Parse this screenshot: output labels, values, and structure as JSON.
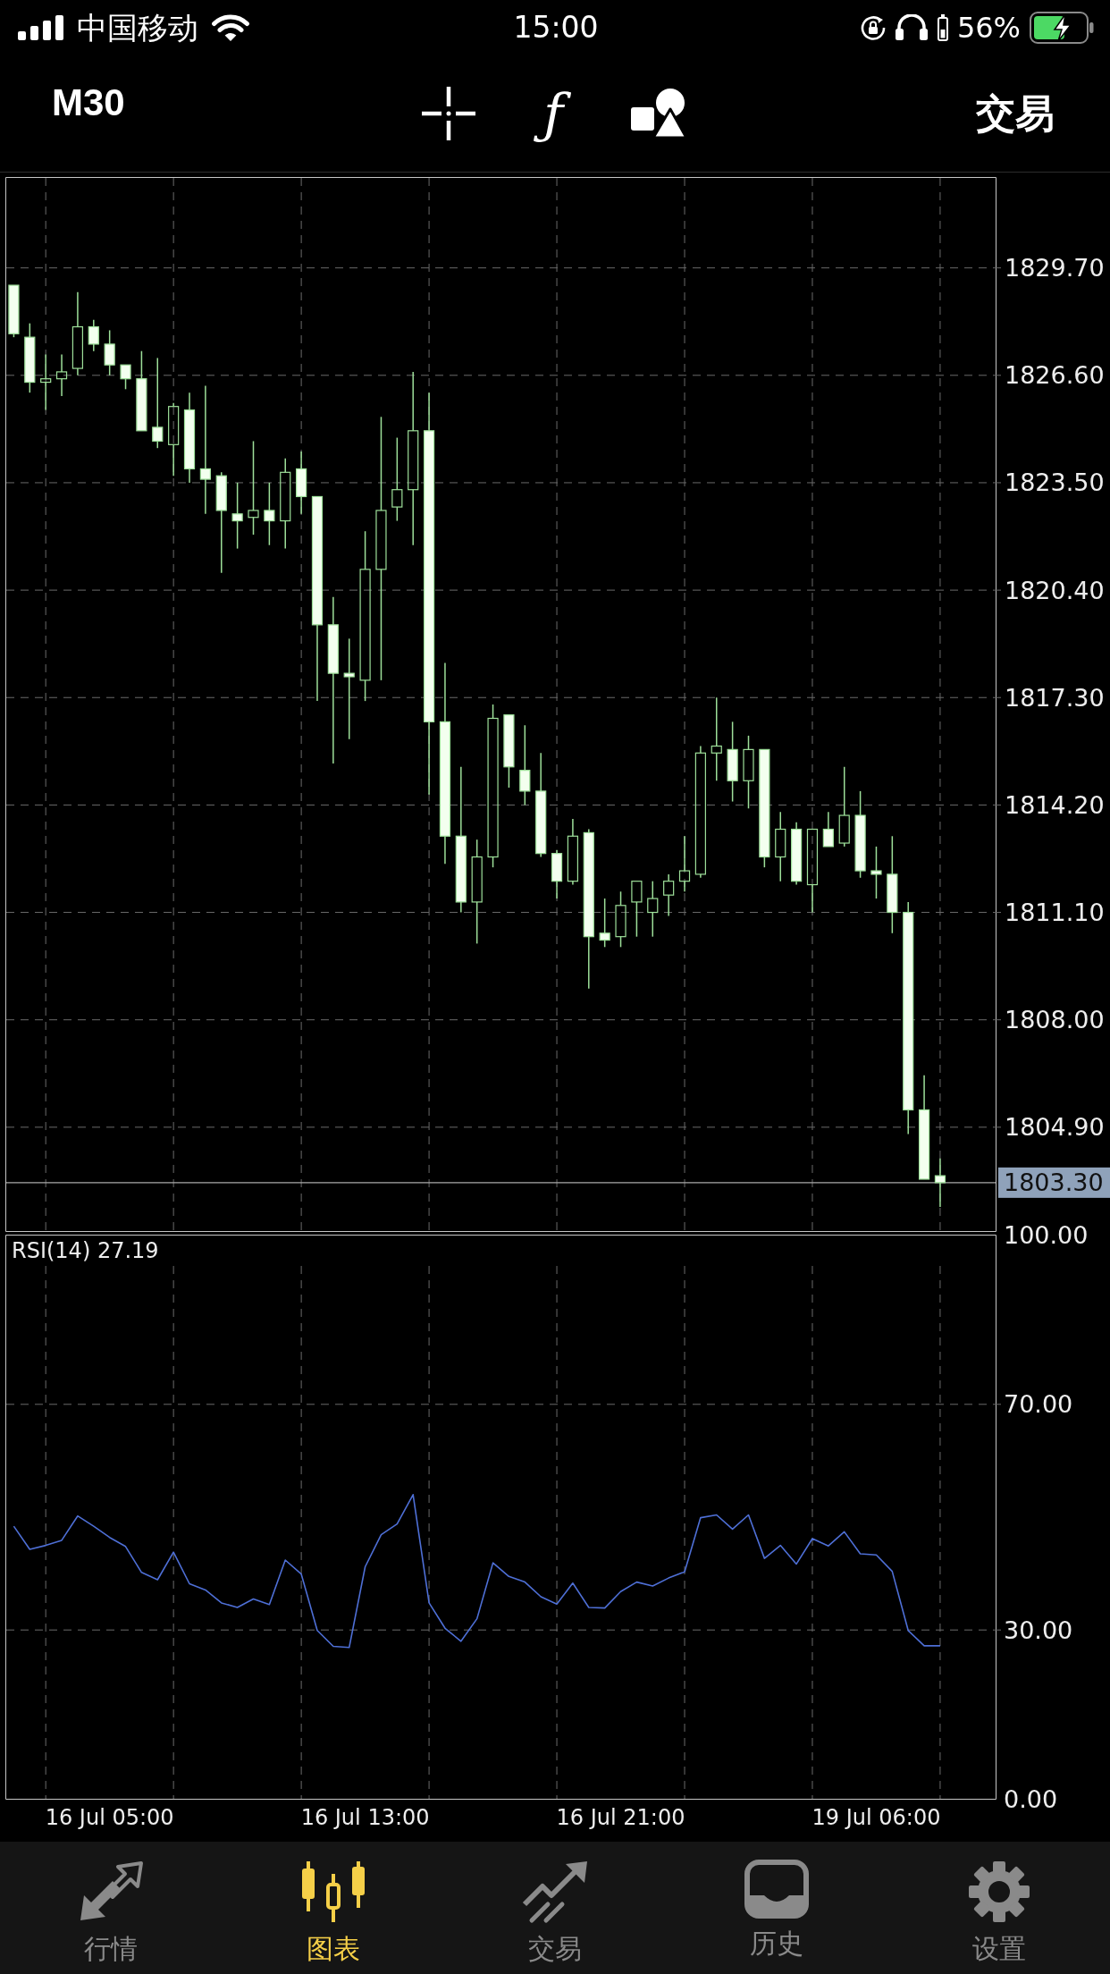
{
  "status_bar": {
    "carrier": "中国移动",
    "time": "15:00",
    "battery": "56%"
  },
  "toolbar": {
    "timeframe": "M30",
    "tools": [
      {
        "kind": "crosshair"
      },
      {
        "kind": "function",
        "glyph": "ƒ"
      },
      {
        "kind": "objects"
      }
    ],
    "action": "交易"
  },
  "price_chart": {
    "chart_data": {
      "type": "candlestick",
      "categories": [
        null,
        null,
        null,
        null,
        null,
        null,
        null,
        null,
        null,
        null,
        null,
        null,
        null,
        null,
        null,
        null,
        null,
        null,
        null,
        null,
        null,
        null,
        null,
        null,
        null,
        null,
        null,
        null,
        null,
        null,
        null,
        null,
        null,
        null,
        null,
        null,
        null,
        null,
        null,
        null,
        null,
        null,
        null,
        null,
        null,
        null,
        null,
        null,
        null,
        null,
        null,
        null,
        null,
        null,
        null,
        null,
        null,
        null,
        null,
        null,
        null,
        null
      ],
      "ohlc": [
        [
          1829.2,
          1829.2,
          1827.7,
          1827.8
        ],
        [
          1827.7,
          1828.1,
          1826.1,
          1826.4
        ],
        [
          1826.4,
          1827.2,
          1825.6,
          1826.5
        ],
        [
          1826.5,
          1827.2,
          1826.0,
          1826.7
        ],
        [
          1826.8,
          1829.0,
          1826.6,
          1828.0
        ],
        [
          1828.0,
          1828.2,
          1827.3,
          1827.5
        ],
        [
          1827.5,
          1827.9,
          1826.6,
          1826.9
        ],
        [
          1826.9,
          1826.9,
          1826.2,
          1826.5
        ],
        [
          1826.5,
          1827.3,
          1825.0,
          1825.0
        ],
        [
          1825.1,
          1827.1,
          1824.5,
          1824.7
        ],
        [
          1824.6,
          1825.8,
          1823.7,
          1825.7
        ],
        [
          1825.6,
          1826.1,
          1823.5,
          1823.9
        ],
        [
          1823.9,
          1826.3,
          1822.6,
          1823.6
        ],
        [
          1823.7,
          1823.8,
          1820.9,
          1822.7
        ],
        [
          1822.6,
          1823.5,
          1821.6,
          1822.4
        ],
        [
          1822.5,
          1824.7,
          1822.0,
          1822.7
        ],
        [
          1822.7,
          1823.5,
          1821.7,
          1822.4
        ],
        [
          1822.4,
          1824.2,
          1821.6,
          1823.8
        ],
        [
          1823.9,
          1824.4,
          1822.6,
          1823.1
        ],
        [
          1823.1,
          1823.1,
          1817.2,
          1819.4
        ],
        [
          1819.4,
          1820.2,
          1815.4,
          1818.0
        ],
        [
          1818.0,
          1819.0,
          1816.1,
          1817.9
        ],
        [
          1817.8,
          1822.1,
          1817.2,
          1821.0
        ],
        [
          1821.0,
          1825.4,
          1817.8,
          1822.7
        ],
        [
          1822.8,
          1824.8,
          1822.4,
          1823.3
        ],
        [
          1823.3,
          1826.7,
          1821.7,
          1825.0
        ],
        [
          1825.0,
          1826.1,
          1814.5,
          1816.6
        ],
        [
          1816.6,
          1818.3,
          1812.5,
          1813.3
        ],
        [
          1813.3,
          1815.3,
          1811.1,
          1811.4
        ],
        [
          1811.4,
          1813.2,
          1810.2,
          1812.7
        ],
        [
          1812.7,
          1817.1,
          1812.4,
          1816.7
        ],
        [
          1816.8,
          1816.8,
          1814.7,
          1815.3
        ],
        [
          1815.2,
          1816.5,
          1814.2,
          1814.6
        ],
        [
          1814.6,
          1815.7,
          1812.7,
          1812.8
        ],
        [
          1812.8,
          1812.9,
          1811.5,
          1812.0
        ],
        [
          1812.0,
          1813.8,
          1811.9,
          1813.3
        ],
        [
          1813.4,
          1813.5,
          1808.9,
          1810.4
        ],
        [
          1810.5,
          1811.5,
          1810.1,
          1810.3
        ],
        [
          1810.4,
          1811.7,
          1810.1,
          1811.3
        ],
        [
          1811.4,
          1812.0,
          1810.4,
          1812.0
        ],
        [
          1811.1,
          1812.0,
          1810.4,
          1811.5
        ],
        [
          1811.6,
          1812.2,
          1811.0,
          1812.0
        ],
        [
          1812.0,
          1813.3,
          1811.7,
          1812.3
        ],
        [
          1812.2,
          1815.9,
          1812.1,
          1815.7
        ],
        [
          1815.7,
          1817.3,
          1814.9,
          1815.9
        ],
        [
          1815.8,
          1816.6,
          1814.3,
          1814.9
        ],
        [
          1814.9,
          1816.2,
          1814.1,
          1815.8
        ],
        [
          1815.8,
          1815.8,
          1812.4,
          1812.7
        ],
        [
          1812.7,
          1814.0,
          1812.0,
          1813.5
        ],
        [
          1813.5,
          1813.7,
          1811.9,
          1812.0
        ],
        [
          1811.9,
          1813.5,
          1811.1,
          1813.5
        ],
        [
          1813.5,
          1814.0,
          1813.0,
          1813.0
        ],
        [
          1813.1,
          1815.3,
          1813.0,
          1813.9
        ],
        [
          1813.9,
          1814.6,
          1812.1,
          1812.3
        ],
        [
          1812.3,
          1813.0,
          1811.5,
          1812.2
        ],
        [
          1812.2,
          1813.3,
          1810.5,
          1811.1
        ],
        [
          1811.1,
          1811.4,
          1804.7,
          1805.4
        ],
        [
          1805.4,
          1806.4,
          1803.4,
          1803.4
        ],
        [
          1803.5,
          1804.0,
          1802.6,
          1803.3
        ],
        null,
        null,
        null
      ],
      "ylim": [
        1801.89,
        1832.31
      ],
      "yticks": [
        {
          "value": 1829.7,
          "label": "1829.70"
        },
        {
          "value": 1826.6,
          "label": "1826.60"
        },
        {
          "value": 1823.5,
          "label": "1823.50"
        },
        {
          "value": 1820.4,
          "label": "1820.40"
        },
        {
          "value": 1817.3,
          "label": "1817.30"
        },
        {
          "value": 1814.2,
          "label": "1814.20"
        },
        {
          "value": 1811.1,
          "label": "1811.10"
        },
        {
          "value": 1808.0,
          "label": "1808.00"
        },
        {
          "value": 1804.9,
          "label": "1804.90"
        }
      ],
      "grid": true,
      "ref_lines": [
        {
          "axis": "y",
          "value": 1803.3,
          "label": "1803.30"
        }
      ]
    }
  },
  "indicator": {
    "chart_data": {
      "type": "line",
      "title": "RSI(14) 27.19",
      "categories": [
        null,
        null,
        null,
        null,
        null,
        null,
        "16 Jul 05:00",
        null,
        null,
        null,
        null,
        null,
        null,
        null,
        null,
        null,
        null,
        null,
        null,
        null,
        null,
        null,
        "16 Jul 13:00",
        null,
        null,
        null,
        null,
        null,
        null,
        null,
        null,
        null,
        null,
        null,
        null,
        null,
        null,
        null,
        "16 Jul 21:00",
        null,
        null,
        null,
        null,
        null,
        null,
        null,
        null,
        null,
        null,
        null,
        null,
        null,
        null,
        null,
        "19 Jul 06:00",
        null,
        null,
        null,
        null,
        null,
        null,
        null
      ],
      "series": [
        {
          "color": "#4e6fd6",
          "values": [
            48.4,
            44.3,
            45.0,
            45.9,
            50.2,
            48.4,
            46.4,
            44.8,
            40.2,
            38.9,
            43.8,
            38.2,
            37.1,
            34.8,
            34.0,
            35.5,
            34.5,
            42.4,
            39.9,
            29.9,
            27.1,
            26.9,
            41.2,
            46.9,
            48.8,
            54.0,
            34.8,
            30.3,
            28.0,
            32.0,
            41.9,
            39.5,
            38.5,
            35.9,
            34.6,
            38.3,
            34.0,
            33.9,
            36.8,
            38.5,
            37.8,
            39.2,
            40.3,
            49.9,
            50.4,
            47.9,
            50.4,
            42.7,
            45.0,
            41.7,
            46.2,
            44.9,
            47.4,
            43.5,
            43.3,
            40.4,
            29.9,
            27.2,
            27.2,
            null,
            null,
            null
          ]
        }
      ],
      "ylim": [
        0,
        100
      ],
      "yticks": [
        {
          "value": 100,
          "label": "100.00"
        },
        {
          "value": 70,
          "label": "70.00"
        },
        {
          "value": 30,
          "label": "30.00"
        },
        {
          "value": 0,
          "label": "0.00"
        }
      ],
      "grid": true
    }
  },
  "tabs": [
    {
      "label": "行情",
      "kind": "quotes",
      "selected": false
    },
    {
      "label": "图表",
      "kind": "chart",
      "selected": true
    },
    {
      "label": "交易",
      "kind": "trade",
      "selected": false
    },
    {
      "label": "历史",
      "kind": "history",
      "selected": false
    },
    {
      "label": "设置",
      "kind": "settings",
      "selected": false
    }
  ]
}
